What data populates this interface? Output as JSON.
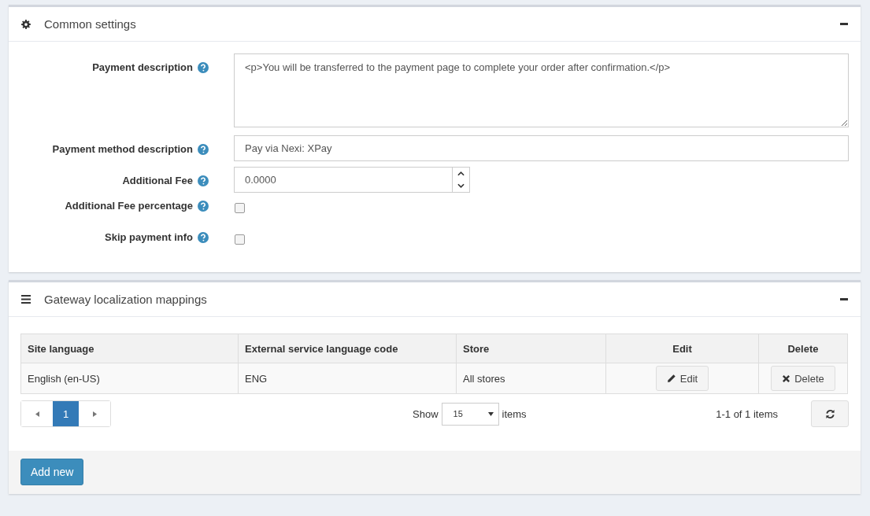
{
  "common_settings": {
    "title": "Common settings",
    "fields": [
      {
        "kind": "textarea",
        "label": "Payment description",
        "value": "<p>You will be transferred to the payment page to complete your order after confirmation.</p>"
      },
      {
        "kind": "text",
        "label": "Payment method description",
        "value": "Pay via Nexi: XPay"
      },
      {
        "kind": "number",
        "label": "Additional Fee",
        "value": "0.0000"
      },
      {
        "kind": "checkbox",
        "label": "Additional Fee percentage",
        "checked": false
      },
      {
        "kind": "checkbox",
        "label": "Skip payment info",
        "checked": false
      }
    ]
  },
  "mappings": {
    "title": "Gateway localization mappings",
    "table": {
      "columns": [
        "Site language",
        "External service language code",
        "Store",
        "Edit",
        "Delete"
      ],
      "rows": [
        {
          "site_language": "English (en-US)",
          "code": "ENG",
          "store": "All stores",
          "edit": "Edit",
          "delete": "Delete"
        }
      ]
    },
    "pager": {
      "pages": [
        {
          "label": "1",
          "selected": true
        }
      ],
      "show_label": "Show",
      "page_size": "15",
      "items_label": "items",
      "summary": "1-1 of 1 items"
    },
    "add_button": "Add new"
  }
}
